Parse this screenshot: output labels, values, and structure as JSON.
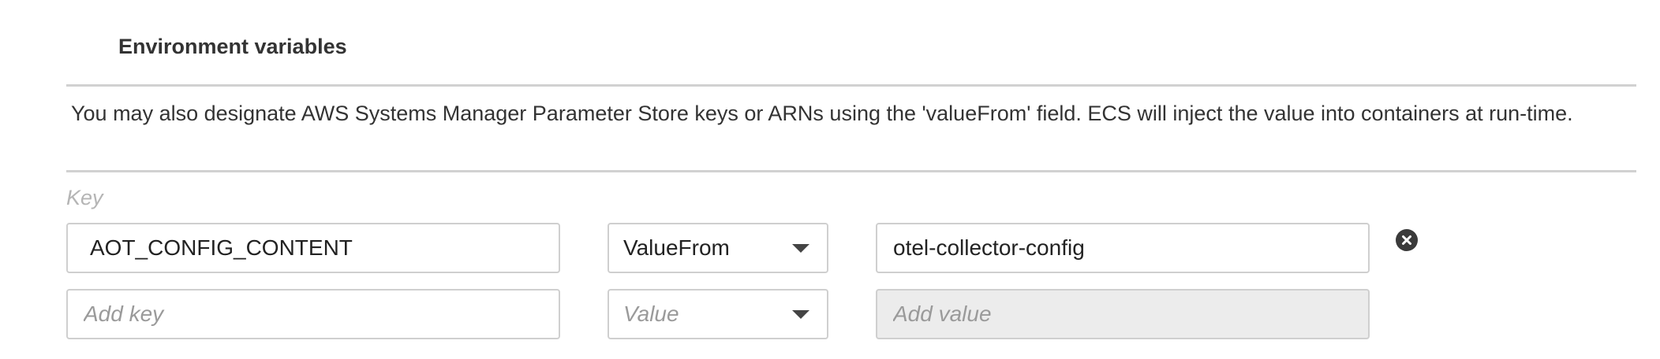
{
  "section": {
    "title": "Environment variables",
    "help_text": "You may also designate AWS Systems Manager Parameter Store keys or ARNs using the 'valueFrom' field. ECS will inject the value into containers at run-time."
  },
  "columns": {
    "key_label": "Key"
  },
  "rows": [
    {
      "key": "AOT_CONFIG_CONTENT",
      "type": "ValueFrom",
      "value": "otel-collector-config",
      "remove_icon": "close-circle-icon"
    },
    {
      "key_placeholder": "Add key",
      "type_placeholder": "Value",
      "value_placeholder": "Add value"
    }
  ],
  "colors": {
    "border": "#cfcfcf",
    "rule": "#d1d1d1",
    "disabled_bg": "#ececec",
    "icon": "#3a3a3a"
  }
}
